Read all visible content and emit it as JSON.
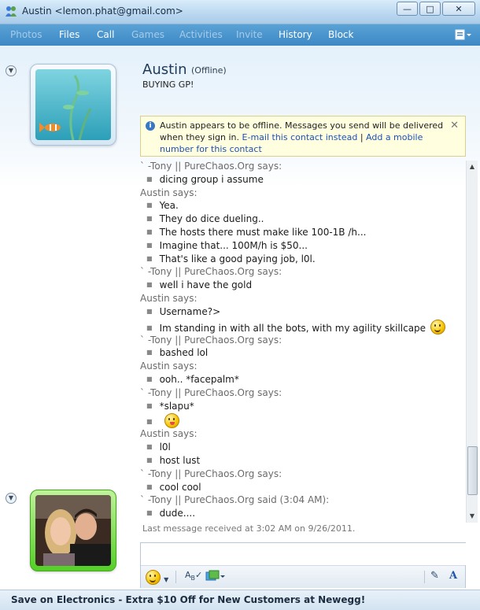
{
  "window": {
    "title": "Austin <lemon.phat@gmail.com>",
    "controls": {
      "minimize": "—",
      "maximize": "□",
      "close": "✕"
    }
  },
  "menu": {
    "items": [
      {
        "label": "Photos",
        "enabled": false
      },
      {
        "label": "Files",
        "enabled": true
      },
      {
        "label": "Call",
        "enabled": true
      },
      {
        "label": "Games",
        "enabled": false
      },
      {
        "label": "Activities",
        "enabled": false
      },
      {
        "label": "Invite",
        "enabled": false
      },
      {
        "label": "History",
        "enabled": true
      },
      {
        "label": "Block",
        "enabled": true
      }
    ]
  },
  "contact": {
    "name": "Austin",
    "status": "(Offline)",
    "personal_message": "BUYING GP!"
  },
  "infobar": {
    "text": "Austin appears to be offline. Messages you send will be delivered when they sign in.",
    "link_email": "E-mail this contact instead",
    "separator": "|",
    "link_mobile": "Add a mobile number for this contact",
    "close": "✕"
  },
  "conversation": [
    {
      "type": "sender",
      "text": "`   -Tony || PureChaos.Org says:"
    },
    {
      "type": "msg",
      "text": "dicing group i assume"
    },
    {
      "type": "sender",
      "text": "Austin says:"
    },
    {
      "type": "msg",
      "text": "Yea."
    },
    {
      "type": "msg",
      "text": "They do dice dueling.."
    },
    {
      "type": "msg",
      "text": "The hosts there must make like 100-1B /h..."
    },
    {
      "type": "msg",
      "text": "Imagine that... 100M/h is $50..."
    },
    {
      "type": "msg",
      "text": "That's like a good paying job, l0l."
    },
    {
      "type": "sender",
      "text": "`   -Tony || PureChaos.Org says:"
    },
    {
      "type": "msg",
      "text": "well i have the gold"
    },
    {
      "type": "sender",
      "text": "Austin says:"
    },
    {
      "type": "msg",
      "text": "Username?>"
    },
    {
      "type": "msg",
      "text": "Im standing in with all the bots, with my agility skillcape",
      "emoticon": "smile"
    },
    {
      "type": "sender",
      "text": "`   -Tony || PureChaos.Org says:"
    },
    {
      "type": "msg",
      "text": "bashed lol"
    },
    {
      "type": "sender",
      "text": "Austin says:"
    },
    {
      "type": "msg",
      "text": "ooh.. *facepalm*"
    },
    {
      "type": "sender",
      "text": "`   -Tony || PureChaos.Org says:"
    },
    {
      "type": "msg",
      "text": "*slapu*"
    },
    {
      "type": "msg",
      "text": "",
      "emoticon": "tongue"
    },
    {
      "type": "sender",
      "text": "Austin says:"
    },
    {
      "type": "msg",
      "text": "l0l"
    },
    {
      "type": "msg",
      "text": "host lust"
    },
    {
      "type": "sender",
      "text": "`   -Tony || PureChaos.Org says:"
    },
    {
      "type": "msg",
      "text": "cool cool"
    },
    {
      "type": "sender",
      "text": "`   -Tony || PureChaos.Org said (3:04 AM):"
    },
    {
      "type": "msg",
      "text": "dude...."
    }
  ],
  "last_message": "Last message received at 3:02 AM on 9/26/2011.",
  "compose": {
    "value": ""
  },
  "toolbar": {
    "emoticon": "☺",
    "font": "A"
  },
  "ad": {
    "text": "Save on Electronics - Extra $10 Off for New Customers at Newegg!"
  },
  "colors": {
    "accent": "#3d87c5",
    "link": "#1e50b4",
    "online_frame": "#52cf25"
  }
}
